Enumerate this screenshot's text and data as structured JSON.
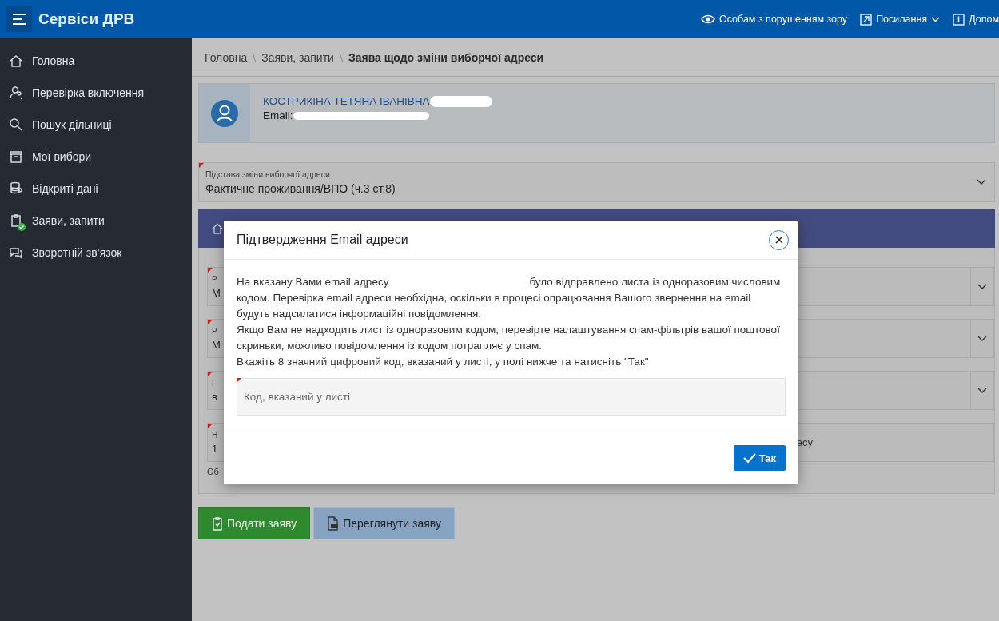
{
  "header": {
    "title": "Сервіси ДРВ",
    "links": [
      {
        "label": "Особам з порушенням зору",
        "dropdown": false
      },
      {
        "label": "Посилання",
        "dropdown": true
      },
      {
        "label": "Допом",
        "dropdown": false
      }
    ]
  },
  "sidebar": {
    "items": [
      {
        "label": "Головна",
        "badge": false
      },
      {
        "label": "Перевірка включення",
        "badge": false
      },
      {
        "label": "Пошук дільниці",
        "badge": false
      },
      {
        "label": "Мої вибори",
        "badge": false
      },
      {
        "label": "Відкриті дані",
        "badge": false
      },
      {
        "label": "Заяви, запити",
        "badge": true
      },
      {
        "label": "Зворотній зв’язок",
        "badge": false
      }
    ]
  },
  "breadcrumb": [
    "Головна",
    "Заяви, запити",
    "Заява щодо зміни виборчої адреси"
  ],
  "profile": {
    "name": "КОСТРИКІНА ТЕТЯНА ІВАНІВНА",
    "email_label": "Email:"
  },
  "basis_select": {
    "label": "Підстава зміни виборчої адреси",
    "value": "Фактичне проживання/ВПО (ч.3 ст.8)"
  },
  "hidden_fields": [
    {
      "label": "Р",
      "value": "М",
      "dropdown": true
    },
    {
      "label": "Р",
      "value": "М",
      "dropdown": true
    },
    {
      "label": "Г",
      "value": "в",
      "dropdown": true
    },
    {
      "label": "Н",
      "value": "1",
      "dropdown": false,
      "right_text": "есу"
    }
  ],
  "hidden_note": "Об",
  "buttons": [
    {
      "label": "Подати заяву",
      "kind": "submit"
    },
    {
      "label": "Переглянути заяву",
      "kind": "pdf"
    }
  ],
  "dialog": {
    "title": "Підтвердження Email адреси",
    "message_before": "На вказану Вами email адресу",
    "message_after": "було відправлено листа із одноразовим числовим кодом. Перевірка email адреси необхідна, оскільки в процесі опрацювання Вашого звернення на email будуть надсилатися інформаційні повідомлення.",
    "lines": [
      "Якщо Вам не надходить лист із одноразовим кодом, перевірте налаштування спам-фільтрів вашої поштової скриньки, можливо повідомлення із кодом потрапляє у спам.",
      "Вкажіть 8 значний цифровий код, вказаний у листі, у полі нижче та натисніть \"Так\""
    ],
    "code_field": {
      "placeholder": "Код, вказаний у листі"
    },
    "ok_button": "Так"
  }
}
